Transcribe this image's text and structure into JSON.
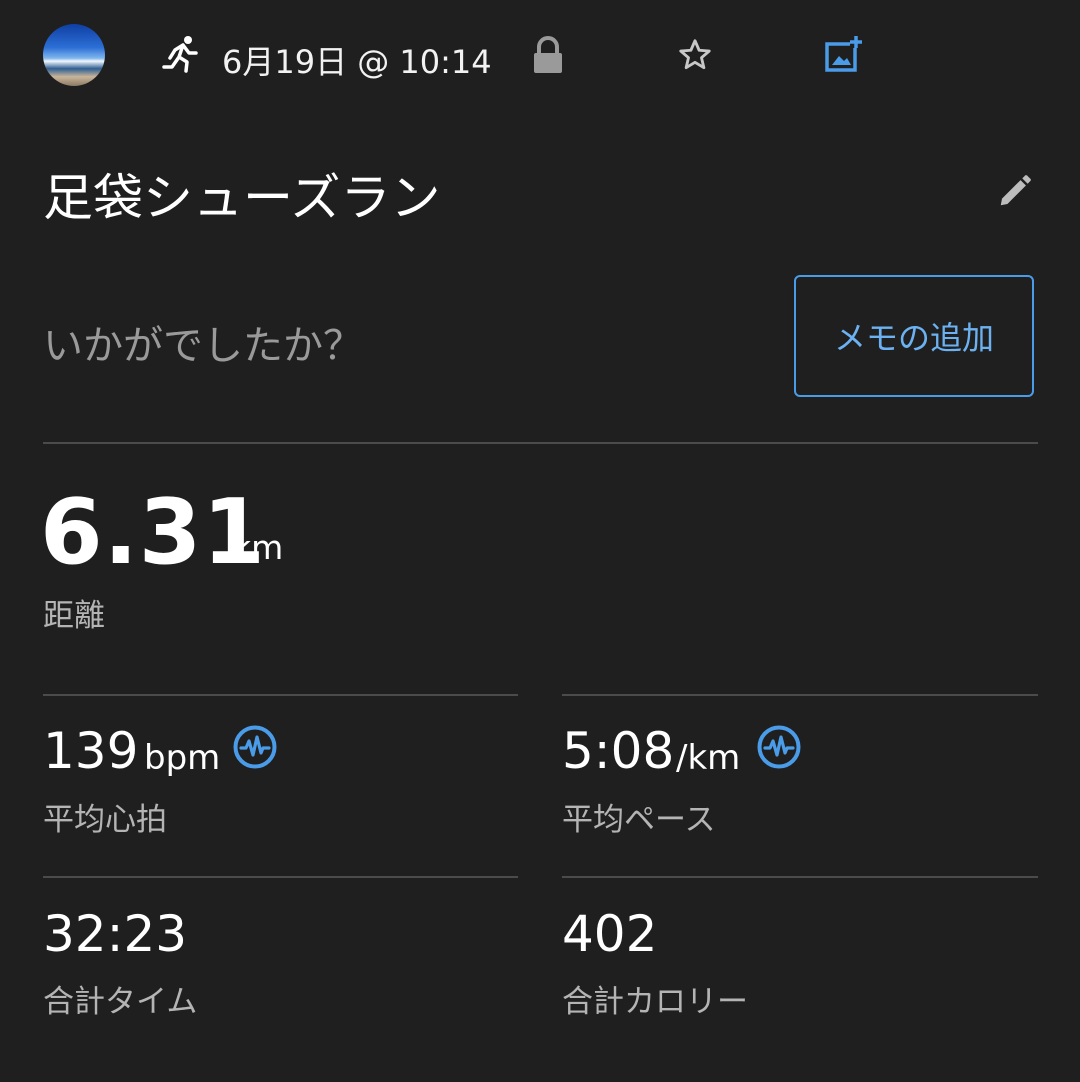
{
  "header": {
    "avatar_icon": "profile-photo",
    "activity_icon": "running-icon",
    "date_time": "6月19日 @ 10:14",
    "lock_icon": "lock-icon",
    "star_icon": "star-outline-icon",
    "add_photo_icon": "add-photo-icon"
  },
  "activity": {
    "title": "足袋シューズラン",
    "edit_icon": "pencil-icon"
  },
  "memo": {
    "prompt": "いかがでしたか？",
    "button_label": "メモの追加"
  },
  "distance": {
    "value": "6.31",
    "unit": "km",
    "label": "距離"
  },
  "stats": {
    "heart_rate": {
      "value": "139",
      "unit": "bpm",
      "label": "平均心拍",
      "icon": "heart-rate-sensor-icon"
    },
    "pace": {
      "value": "5:08",
      "unit": "/km",
      "label": "平均ペース",
      "icon": "heart-rate-sensor-icon"
    },
    "time": {
      "value": "32:23",
      "label": "合計タイム"
    },
    "calories": {
      "value": "402",
      "label": "合計カロリー"
    }
  },
  "colors": {
    "background": "#1f1f1f",
    "accent_blue": "#4a9ce8",
    "label_gray": "#b4b4b4",
    "divider": "#4b4b4b"
  }
}
